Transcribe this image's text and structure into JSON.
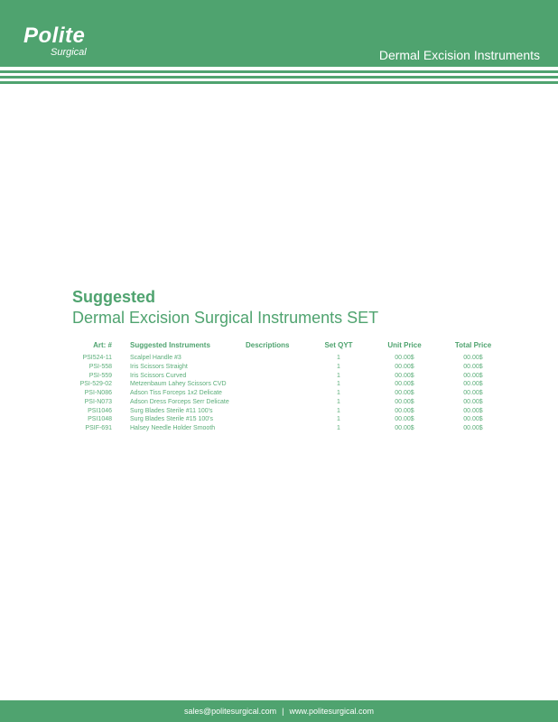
{
  "header": {
    "logo_main": "Polite",
    "logo_sub": "Surgical",
    "title": "Dermal Excision Instruments"
  },
  "heading": {
    "bold": "Suggested",
    "subtitle": "Dermal Excision Surgical Instruments SET"
  },
  "table": {
    "columns": [
      "Art: #",
      "Suggested Instruments",
      "Descriptions",
      "Set QYT",
      "Unit Price",
      "Total Price"
    ],
    "rows": [
      {
        "art": "PSI524-11",
        "name": "Scalpel Handle #3",
        "desc": "",
        "qty": "1",
        "unit": "00.00$",
        "total": "00.00$"
      },
      {
        "art": "PSI-558",
        "name": "Iris Scissors Straight",
        "desc": "",
        "qty": "1",
        "unit": "00.00$",
        "total": "00.00$"
      },
      {
        "art": "PSI-559",
        "name": "Iris Scissors Curved",
        "desc": "",
        "qty": "1",
        "unit": "00.00$",
        "total": "00.00$"
      },
      {
        "art": "PSI-529-02",
        "name": "Metzenbaum Lahey Scissors CVD",
        "desc": "",
        "qty": "1",
        "unit": "00.00$",
        "total": "00.00$"
      },
      {
        "art": "PSI-N086",
        "name": "Adson Tiss Forceps 1x2 Delicate",
        "desc": "",
        "qty": "1",
        "unit": "00.00$",
        "total": "00.00$"
      },
      {
        "art": "PSI-N073",
        "name": "Adson Dress Forceps Serr Delicate",
        "desc": "",
        "qty": "1",
        "unit": "00.00$",
        "total": "00.00$"
      },
      {
        "art": "PSI1046",
        "name": "Surg Blades Sterile #11 100's",
        "desc": "",
        "qty": "1",
        "unit": "00.00$",
        "total": "00.00$"
      },
      {
        "art": "PSI1048",
        "name": "Surg Blades Sterile #15 100's",
        "desc": "",
        "qty": "1",
        "unit": "00.00$",
        "total": "00.00$"
      },
      {
        "art": "PSIF-691",
        "name": "Halsey Needle Holder Smooth",
        "desc": "",
        "qty": "1",
        "unit": "00.00$",
        "total": "00.00$"
      }
    ]
  },
  "footer": {
    "email": "sales@politesurgical.com",
    "separator": "|",
    "website": "www.politesurgical.com"
  },
  "colors": {
    "brand_green": "#4fa36f",
    "background": "#ffffff"
  }
}
